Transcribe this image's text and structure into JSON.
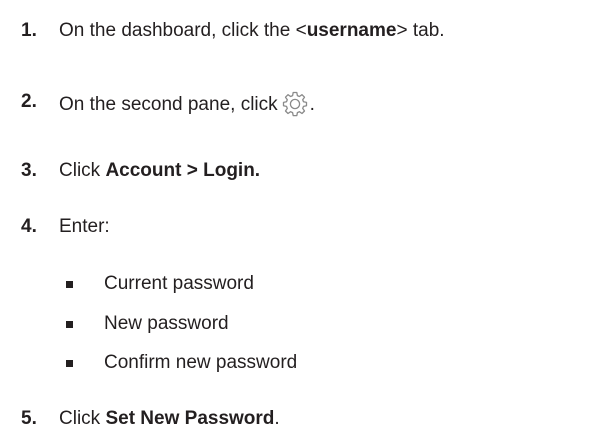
{
  "steps": [
    {
      "number": "1.",
      "pre": "On the dashboard, click the <",
      "bold": "username",
      "post": "> tab."
    },
    {
      "number": "2.",
      "pre": "On the second pane, click",
      "icon": "gear-icon",
      "post": "."
    },
    {
      "number": "3.",
      "pre": "Click ",
      "bold": "Account > Login."
    },
    {
      "number": "4.",
      "pre": "Enter:",
      "bullets": [
        "Current password",
        "New password",
        "Confirm new password"
      ]
    },
    {
      "number": "5.",
      "pre": "Click ",
      "bold": "Set New Password",
      "post": "."
    }
  ],
  "colors": {
    "text": "#231f20",
    "icon": "#8a8a8a"
  }
}
